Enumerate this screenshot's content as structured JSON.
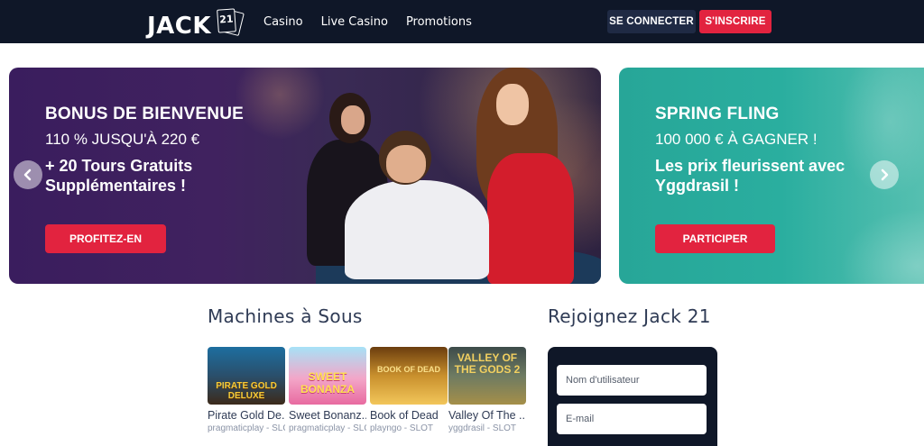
{
  "header": {
    "logo_text": "JACK",
    "logo_number": "21",
    "nav": [
      "Casino",
      "Live Casino",
      "Promotions"
    ],
    "login_label": "SE CONNECTER",
    "register_label": "S'INSCRIRE"
  },
  "slides": [
    {
      "title": "BONUS DE BIENVENUE",
      "subtitle": "110 % JUSQU'À 220 €",
      "body": "+ 20 Tours Gratuits Supplémentaires !",
      "button": "PROFITEZ-EN"
    },
    {
      "title": "SPRING FLING",
      "subtitle": "100 000 € À GAGNER !",
      "body": "Les prix fleurissent avec Yggdrasil !",
      "button": "PARTICIPER"
    }
  ],
  "slots": {
    "title": "Machines à Sous",
    "games": [
      {
        "name": "Pirate Gold De...",
        "meta": "pragmaticplay - SLOT",
        "thumb": "PIRATE GOLD DELUXE"
      },
      {
        "name": "Sweet Bonanz...",
        "meta": "pragmaticplay - SLOT",
        "thumb": "SWEET BONANZA"
      },
      {
        "name": "Book of Dead",
        "meta": "playngo - SLOT",
        "thumb": "BOOK OF DEAD"
      },
      {
        "name": "Valley Of The ...",
        "meta": "yggdrasil - SLOT",
        "thumb": "VALLEY OF THE GODS 2"
      }
    ]
  },
  "join": {
    "title": "Rejoignez Jack 21",
    "username_placeholder": "Nom d'utilisateur",
    "email_placeholder": "E-mail"
  },
  "colors": {
    "header_bg": "#0f1728",
    "accent_red": "#e2233f",
    "login_bg": "#1f2a44",
    "slide1_bg": "#3a1d5e",
    "slide2_bg": "#27a698"
  },
  "icons": {
    "prev": "chevron-left-icon",
    "next": "chevron-right-icon"
  }
}
